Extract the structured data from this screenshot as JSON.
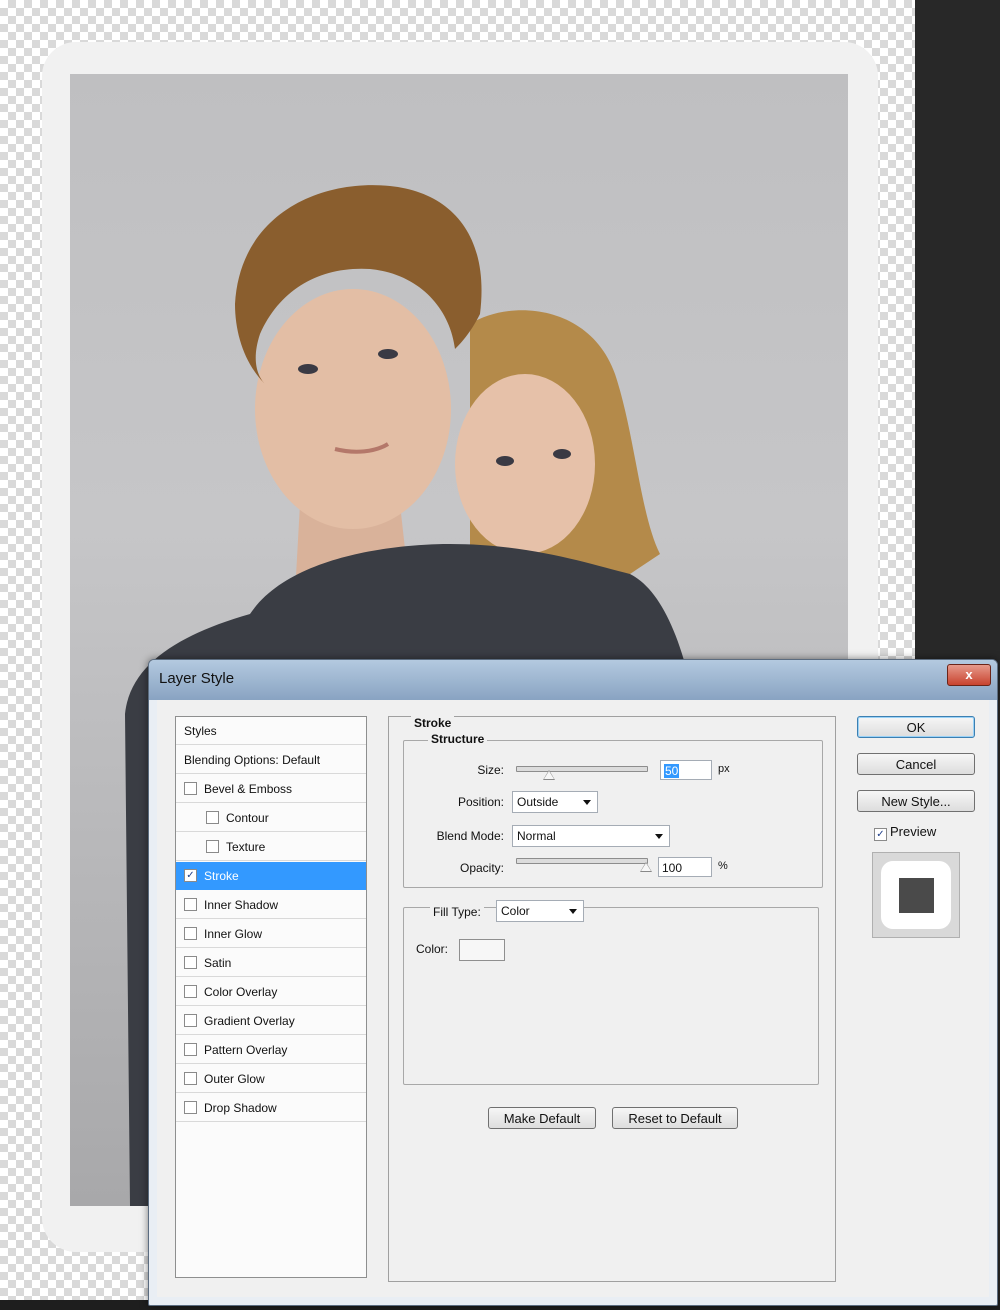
{
  "dialog": {
    "title": "Layer Style",
    "close_label": "x"
  },
  "styles_list": {
    "items": [
      {
        "label": "Styles",
        "checkbox": false,
        "checked": false,
        "indent": 0
      },
      {
        "label": "Blending Options: Default",
        "checkbox": false,
        "checked": false,
        "indent": 0
      },
      {
        "label": "Bevel & Emboss",
        "checkbox": true,
        "checked": false,
        "indent": 0
      },
      {
        "label": "Contour",
        "checkbox": true,
        "checked": false,
        "indent": 1
      },
      {
        "label": "Texture",
        "checkbox": true,
        "checked": false,
        "indent": 1
      },
      {
        "label": "Stroke",
        "checkbox": true,
        "checked": true,
        "indent": 0,
        "selected": true
      },
      {
        "label": "Inner Shadow",
        "checkbox": true,
        "checked": false,
        "indent": 0
      },
      {
        "label": "Inner Glow",
        "checkbox": true,
        "checked": false,
        "indent": 0
      },
      {
        "label": "Satin",
        "checkbox": true,
        "checked": false,
        "indent": 0
      },
      {
        "label": "Color Overlay",
        "checkbox": true,
        "checked": false,
        "indent": 0
      },
      {
        "label": "Gradient Overlay",
        "checkbox": true,
        "checked": false,
        "indent": 0
      },
      {
        "label": "Pattern Overlay",
        "checkbox": true,
        "checked": false,
        "indent": 0
      },
      {
        "label": "Outer Glow",
        "checkbox": true,
        "checked": false,
        "indent": 0
      },
      {
        "label": "Drop Shadow",
        "checkbox": true,
        "checked": false,
        "indent": 0
      }
    ]
  },
  "stroke": {
    "title": "Stroke",
    "structure_title": "Structure",
    "size_label": "Size:",
    "size_value": "50",
    "size_unit": "px",
    "size_fraction": 0.25,
    "position_label": "Position:",
    "position_value": "Outside",
    "blend_mode_label": "Blend Mode:",
    "blend_mode_value": "Normal",
    "opacity_label": "Opacity:",
    "opacity_value": "100",
    "opacity_unit": "%",
    "opacity_fraction": 1.0,
    "fill_type_label": "Fill Type:",
    "fill_type_value": "Color",
    "color_label": "Color:",
    "color_value": "#f7f7f7",
    "make_default_label": "Make Default",
    "reset_default_label": "Reset to Default"
  },
  "actions": {
    "ok_label": "OK",
    "cancel_label": "Cancel",
    "new_style_label": "New Style...",
    "preview_label": "Preview",
    "preview_checked": true
  },
  "colors": {
    "selection": "#3399ff",
    "title_bar": "#8ca8c8",
    "close_button": "#c8432f",
    "preview_swatch": "#4a4a4a"
  }
}
